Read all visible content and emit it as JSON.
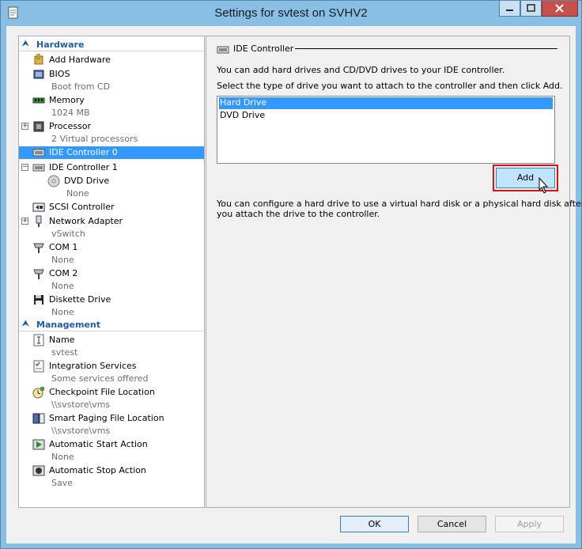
{
  "window": {
    "title": "Settings for svtest on SVHV2"
  },
  "colors": {
    "selection": "#3399ff",
    "header": "#1e5ca8",
    "highlight_outline": "#d0161c",
    "titlebar": "#88bfe4"
  },
  "tree": {
    "hardware_header": "Hardware",
    "management_header": "Management",
    "add_hardware": "Add Hardware",
    "bios": {
      "label": "BIOS",
      "sub": "Boot from CD"
    },
    "memory": {
      "label": "Memory",
      "sub": "1024 MB"
    },
    "processor": {
      "label": "Processor",
      "sub": "2 Virtual processors"
    },
    "ide0": {
      "label": "IDE Controller 0"
    },
    "ide1": {
      "label": "IDE Controller 1"
    },
    "dvd": {
      "label": "DVD Drive",
      "sub": "None"
    },
    "scsi": {
      "label": "SCSI Controller"
    },
    "network": {
      "label": "Network Adapter",
      "sub": "vSwitch"
    },
    "com1": {
      "label": "COM 1",
      "sub": "None"
    },
    "com2": {
      "label": "COM 2",
      "sub": "None"
    },
    "diskette": {
      "label": "Diskette Drive",
      "sub": "None"
    },
    "name": {
      "label": "Name",
      "sub": "svtest"
    },
    "integration": {
      "label": "Integration Services",
      "sub": "Some services offered"
    },
    "checkpoint": {
      "label": "Checkpoint File Location",
      "sub": "\\\\svstore\\vms"
    },
    "paging": {
      "label": "Smart Paging File Location",
      "sub": "\\\\svstore\\vms"
    },
    "autostart": {
      "label": "Automatic Start Action",
      "sub": "None"
    },
    "autostop": {
      "label": "Automatic Stop Action",
      "sub": "Save"
    }
  },
  "panel": {
    "group_title": "IDE Controller",
    "intro": "You can add hard drives and CD/DVD drives to your IDE controller.",
    "instruction": "Select the type of drive you want to attach to the controller and then click Add.",
    "drive_types": [
      "Hard Drive",
      "DVD Drive"
    ],
    "add_label": "Add",
    "note_line1": "You can configure a hard drive to use a virtual hard disk or a physical hard disk after",
    "note_line2": "you attach the drive to the controller."
  },
  "footer": {
    "ok": "OK",
    "cancel": "Cancel",
    "apply": "Apply"
  }
}
